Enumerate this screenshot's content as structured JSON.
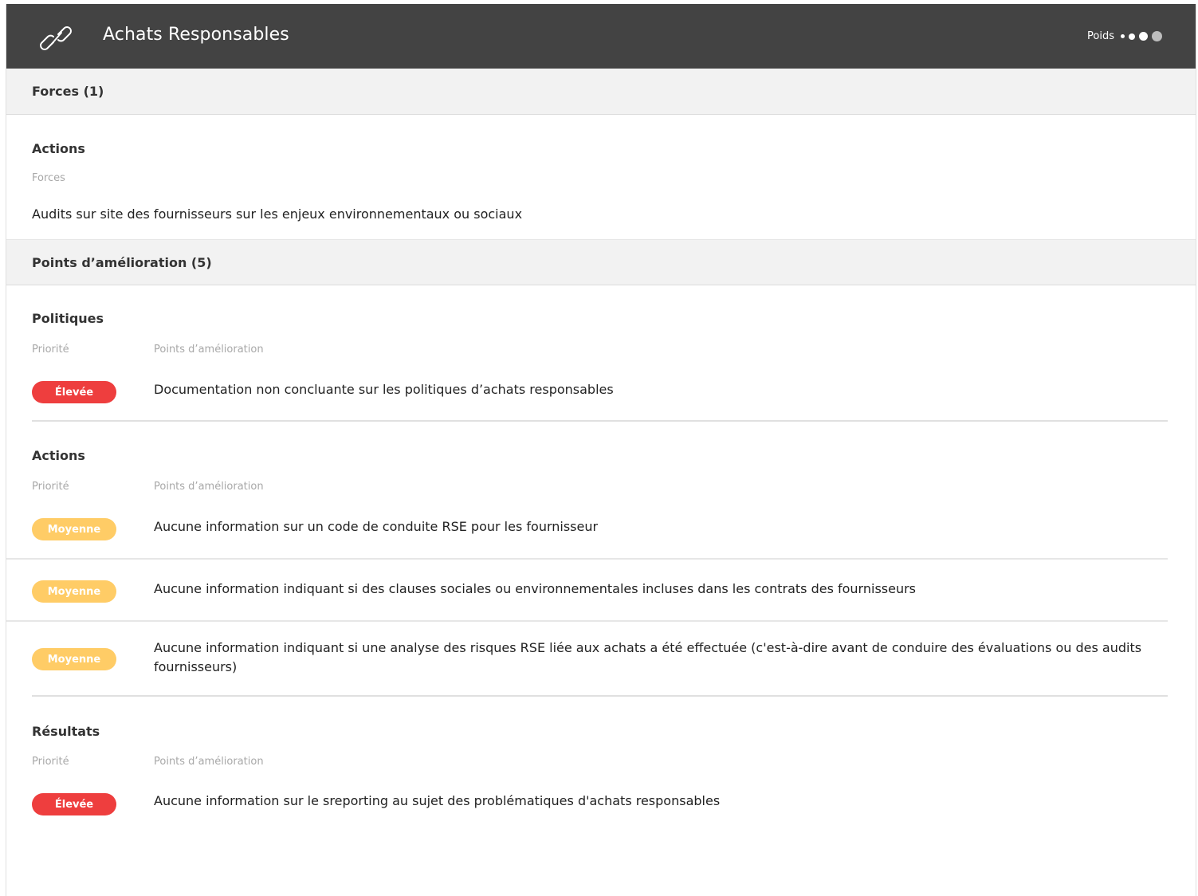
{
  "header": {
    "title": "Achats Responsables",
    "icon": "link-icon",
    "weight_label": "Poids",
    "weight_level": 3,
    "weight_max": 4
  },
  "strengths": {
    "title": "Forces (1)",
    "group_title": "Actions",
    "column_label": "Forces",
    "items": [
      "Audits sur site des fournisseurs sur les enjeux environnementaux ou sociaux"
    ]
  },
  "improvements": {
    "title": "Points d’amélioration (5)",
    "col_priority": "Priorité",
    "col_points": "Points d’amélioration",
    "groups": [
      {
        "title": "Politiques",
        "items": [
          {
            "priority": "Élevée",
            "text": "Documentation non concluante sur les politiques d’achats responsables"
          }
        ]
      },
      {
        "title": "Actions",
        "items": [
          {
            "priority": "Moyenne",
            "text": "Aucune information sur un code de conduite RSE pour les fournisseur"
          },
          {
            "priority": "Moyenne",
            "text": "Aucune information indiquant si des clauses sociales ou environnementales incluses dans les contrats des fournisseurs"
          },
          {
            "priority": "Moyenne",
            "text": "Aucune information indiquant si une analyse des risques RSE liée aux achats a été effectuée (c'est-à-dire avant de conduire des évaluations ou des audits fournisseurs)"
          }
        ]
      },
      {
        "title": "Résultats",
        "items": [
          {
            "priority": "Élevée",
            "text": "Aucune information sur le sreporting au sujet des problématiques d'achats responsables"
          }
        ]
      }
    ]
  },
  "colors": {
    "header_bg": "#434343",
    "priority_high": "#ee3e3e",
    "priority_medium": "#ffcc66"
  }
}
